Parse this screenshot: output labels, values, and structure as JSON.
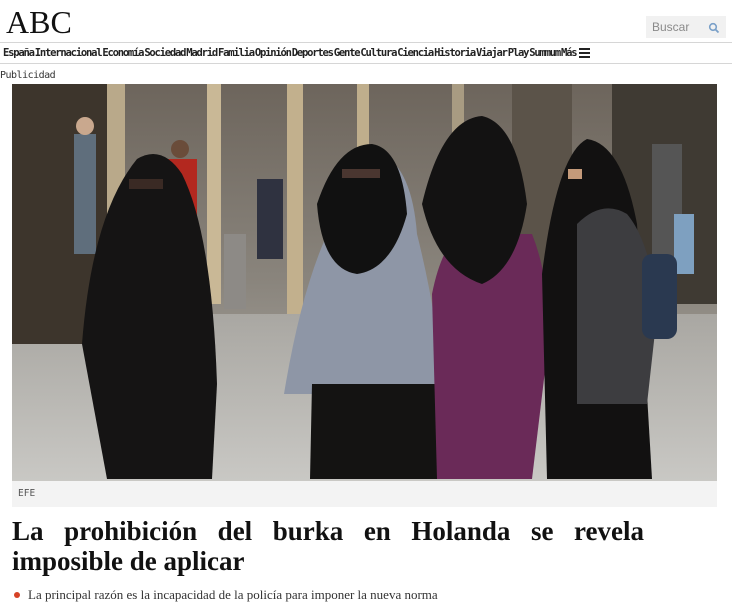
{
  "header": {
    "logo": "ABC",
    "search": {
      "placeholder": "Buscar",
      "icon": "search-icon"
    }
  },
  "nav": {
    "items": [
      "España",
      "Internacional",
      "Economía",
      "Sociedad",
      "Madrid",
      "Familia",
      "Opinión",
      "Deportes",
      "Gente",
      "Cultura",
      "Ciencia",
      "Historia",
      "Viajar",
      "Play",
      "Summum",
      "Más"
    ],
    "menu_icon": "hamburger-menu-icon"
  },
  "ad_label": "Publicidad",
  "article": {
    "image_credit": "EFE",
    "headline": "La prohibición del burka en Holanda se revela imposible de aplicar",
    "subheadline": "La principal razón es la incapacidad de la policía para imponer la nueva norma"
  },
  "colors": {
    "bullet": "#d64226",
    "nav_border": "#d6d6d6",
    "search_bg": "#f1f1f1",
    "caption_bg": "#f3f3f3"
  }
}
